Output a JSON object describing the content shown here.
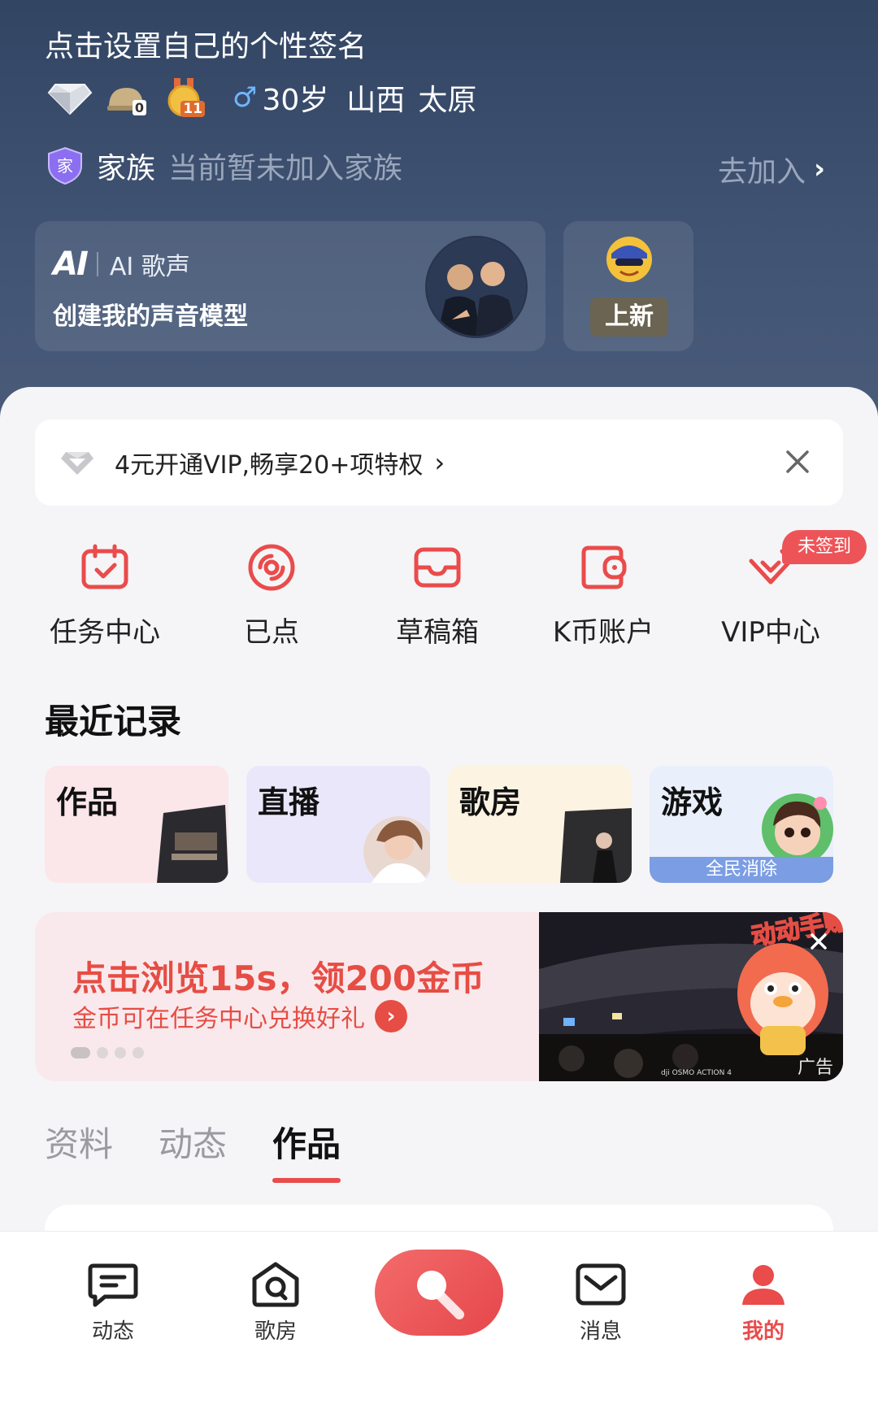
{
  "profile": {
    "signature": "点击设置自己的个性签名",
    "badges": [
      "diamond-badge",
      "helmet-badge",
      "level-medal-badge"
    ],
    "helmet_level": "0",
    "medal_level": "11",
    "gender_symbol": "♂",
    "age": "30岁",
    "province": "山西",
    "city": "太原"
  },
  "family": {
    "shield_char": "家",
    "label": "家族",
    "status": "当前暂未加入家族",
    "join_label": "去加入",
    "join_chevron": "›"
  },
  "ai_card": {
    "logo": "AI",
    "name": "AI 歌声",
    "title": "创建我的声音模型"
  },
  "new_card": {
    "tag": "上新"
  },
  "vip_banner": {
    "text": "4元开通VIP,畅享20+项特权",
    "chevron": "›"
  },
  "quick_actions": [
    {
      "label": "任务中心",
      "icon": "calendar-check-icon"
    },
    {
      "label": "已点",
      "icon": "disc-icon"
    },
    {
      "label": "草稿箱",
      "icon": "inbox-icon"
    },
    {
      "label": "K币账户",
      "icon": "wallet-icon"
    },
    {
      "label": "VIP中心",
      "icon": "vip-diamond-icon"
    }
  ],
  "vip_badge": "未签到",
  "recent": {
    "title": "最近记录",
    "cards": [
      {
        "label": "作品"
      },
      {
        "label": "直播"
      },
      {
        "label": "歌房"
      },
      {
        "label": "游戏",
        "strip": "全民消除"
      }
    ]
  },
  "promo": {
    "title": "点击浏览15s，领200金币",
    "subtitle": "金币可在任务中心兑换好礼",
    "go": "›",
    "overlay_text": "动动手赚钱",
    "camera_watermark": "dji OSMO ACTION 4",
    "ad_label": "广告"
  },
  "tabs": [
    {
      "label": "资料",
      "active": false
    },
    {
      "label": "动态",
      "active": false
    },
    {
      "label": "作品",
      "active": true
    }
  ],
  "bottom_nav": [
    {
      "label": "动态"
    },
    {
      "label": "歌房"
    },
    {
      "label": "消息"
    },
    {
      "label": "我的",
      "active": true
    }
  ],
  "colors": {
    "accent": "#ea4b4b",
    "header_bg": "#3f5170",
    "sheet_bg": "#f5f5f7",
    "male_blue": "#6fb6ff"
  }
}
